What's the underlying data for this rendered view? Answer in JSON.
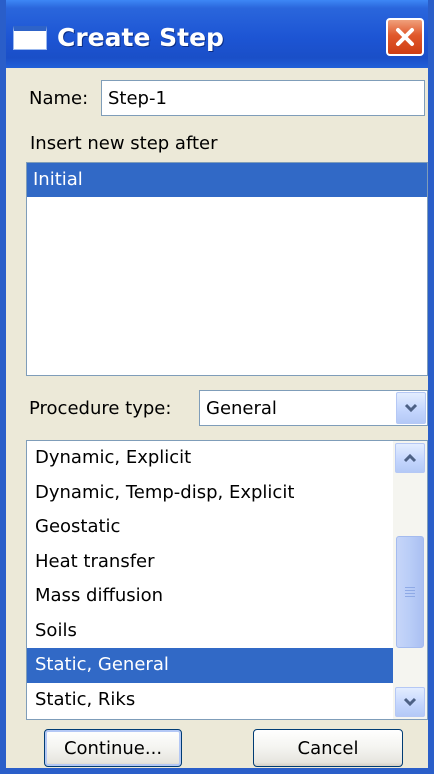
{
  "window": {
    "title": "Create Step"
  },
  "name_field": {
    "label": "Name:",
    "value": "Step-1"
  },
  "insert_after": {
    "label": "Insert new step after",
    "items": [
      "Initial"
    ]
  },
  "procedure_type": {
    "label": "Procedure type:",
    "selected": "General",
    "items": [
      "Dynamic, Explicit",
      "Dynamic, Temp-disp, Explicit",
      "Geostatic",
      "Heat transfer",
      "Mass diffusion",
      "Soils",
      "Static, General",
      "Static, Riks"
    ],
    "selected_item": "Static, General"
  },
  "buttons": {
    "continue": "Continue...",
    "cancel": "Cancel"
  },
  "colors": {
    "titlebar": "#1d55d4",
    "selection": "#3169c6",
    "close_button": "#e0582b",
    "dialog_bg": "#ece9d8"
  },
  "icons": {
    "window": "window-icon",
    "close": "close-icon",
    "dropdown": "chevron-down-icon",
    "scroll_up": "chevron-up-icon",
    "scroll_down": "chevron-down-icon"
  }
}
